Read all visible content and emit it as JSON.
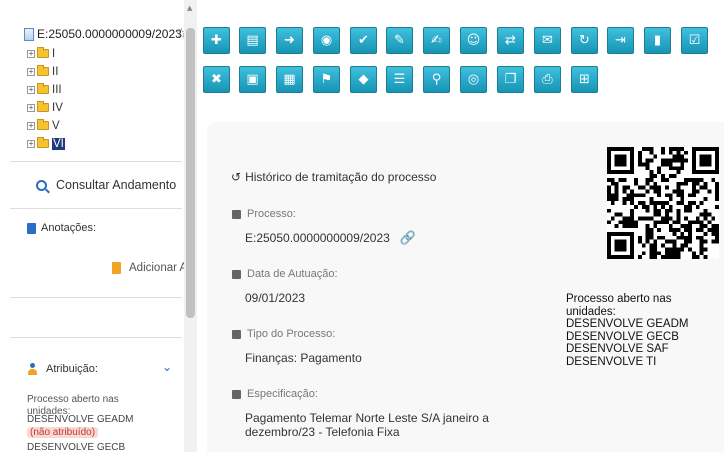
{
  "tree": {
    "root_label": "E:25050.0000000009/2023",
    "items": [
      {
        "label": "I"
      },
      {
        "label": "II"
      },
      {
        "label": "III"
      },
      {
        "label": "IV"
      },
      {
        "label": "V"
      },
      {
        "label": "VI",
        "selected": true
      }
    ]
  },
  "sidebar": {
    "consultar_label": "Consultar Andamento",
    "anotacoes_label": "Anotações:",
    "adicionar_label": "Adicionar Anotação",
    "atribuicao_label": "Atribuição:",
    "aberto_label": "Processo aberto nas unidades:",
    "units": [
      {
        "name": "DESENVOLVE GEADM",
        "status": "(não atribuído)"
      },
      {
        "name": "DESENVOLVE GECB"
      }
    ]
  },
  "toolbar": {
    "icons": [
      "new-document-icon",
      "include-document-icon",
      "send-process-icon",
      "follow-process-icon",
      "like-icon",
      "edit-form-icon",
      "sign-icon",
      "assign-user-icon",
      "relate-process-icon",
      "email-icon",
      "sync-icon",
      "move-document-icon",
      "stats-icon",
      "check-list-icon",
      "pause-icon",
      "edit-icon",
      "cancel-document-icon",
      "pdf-icon",
      "zip-icon",
      "flag-icon",
      "tag-icon",
      "list-icon",
      "search-icon",
      "view-icon",
      "duplicate-icon",
      "print-icon",
      "block-icon"
    ]
  },
  "main": {
    "historico_label": "Histórico de tramitação do processo",
    "processo_label": "Processo:",
    "processo_value": "E:25050.0000000009/2023",
    "data_label": "Data de Autuação:",
    "data_value": "09/01/2023",
    "tipo_label": "Tipo do Processo:",
    "tipo_value": "Finanças: Pagamento",
    "especificacao_label": "Especificação:",
    "especificacao_value": "Pagamento Telemar Norte Leste S/A janeiro a dezembro/23 - Telefonia Fixa",
    "unidades_label": "Processo aberto nas unidades:",
    "unidades": [
      "DESENVOLVE GEADM",
      "DESENVOLVE GECB",
      "DESENVOLVE SAF",
      "DESENVOLVE TI"
    ]
  },
  "colors": {
    "toolbar_icon_bg": "#1fa6c6",
    "selected_node_bg": "#1f3b7a",
    "accent_blue": "#2b6cc4",
    "note_orange": "#f2a324",
    "unassigned_red": "#c0392b"
  }
}
